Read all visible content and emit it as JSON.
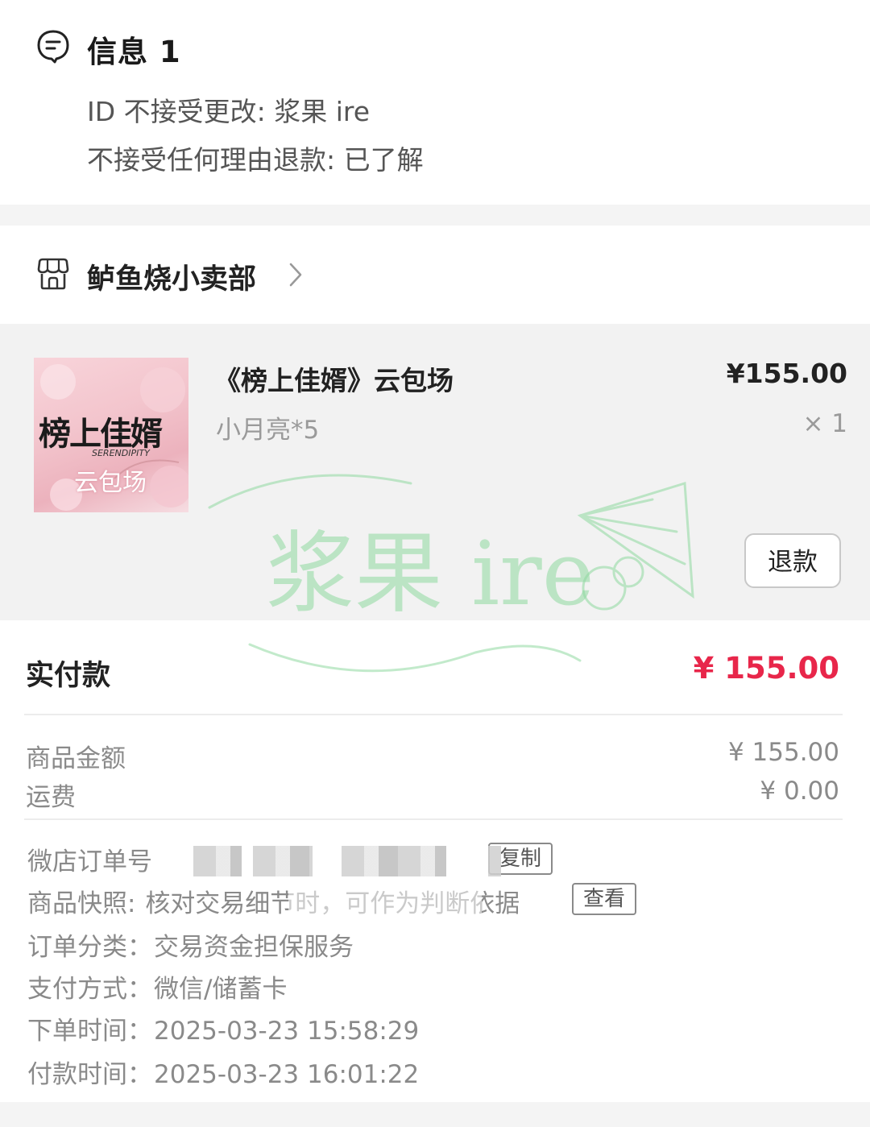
{
  "info": {
    "title": "信息 1",
    "icon": "chat-bubble-icon",
    "id_label": "ID 不接受更改: ",
    "id_value": "浆果 ire",
    "refund_label": "不接受任何理由退款: ",
    "refund_value": "已了解"
  },
  "shop": {
    "name": "鲈鱼烧小卖部",
    "icon": "storefront-icon"
  },
  "product": {
    "name": "《榜上佳婿》云包场",
    "price": "¥155.00",
    "spec": "小月亮*5",
    "qty": "× 1",
    "refund_button": "退款",
    "thumb_title": "榜上佳婿",
    "thumb_small": "SERENDIPITY",
    "thumb_sub": "云包场"
  },
  "watermark": {
    "text": "浆果 ire",
    "color": "#8fd9a0"
  },
  "payment": {
    "paid_label": "实付款",
    "paid_value": "¥ 155.00",
    "goods_label": "商品金额",
    "goods_value": "¥ 155.00",
    "shipping_label": "运费",
    "shipping_value": "¥ 0.00",
    "order_no_label": "微店订单号",
    "copy_button": "复制",
    "snapshot_label": "商品快照: ",
    "snapshot_value": "核对交易细节时，可作为判断依据",
    "view_button": "查看",
    "category_label": "订单分类：",
    "category_value": "交易资金担保服务",
    "method_label": "支付方式：",
    "method_value": "微信/储蓄卡",
    "order_time_label": "下单时间：",
    "order_time_value": "2025-03-23 15:58:29",
    "pay_time_label": "付款时间：",
    "pay_time_value": "2025-03-23 16:01:22"
  },
  "colors": {
    "accent_price": "#e8264a",
    "watermark": "#8fd9a0"
  }
}
